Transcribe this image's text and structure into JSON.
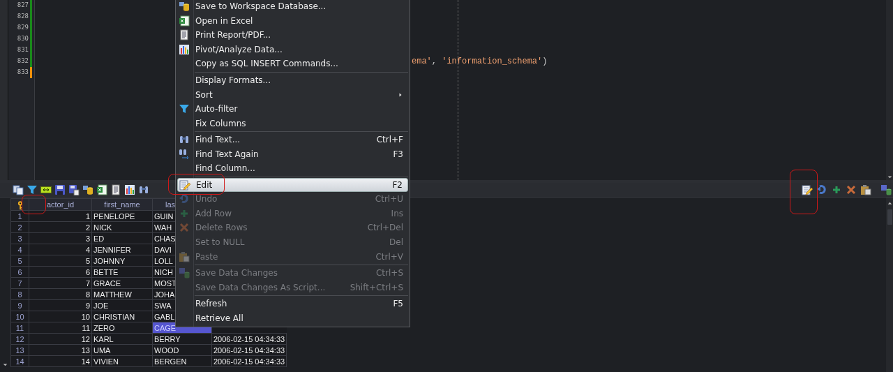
{
  "editor": {
    "lines": [
      {
        "number": "827",
        "color": "#1a8a1a"
      },
      {
        "number": "828",
        "color": "#1a8a1a"
      },
      {
        "number": "829",
        "color": "#1a8a1a"
      },
      {
        "number": "830",
        "color": "#1a8a1a"
      },
      {
        "number": "831",
        "color": "#1a8a1a"
      },
      {
        "number": "832",
        "color": "#1a8a1a",
        "code": [
          {
            "text": "ema'",
            "kind": "string"
          },
          {
            "text": ", ",
            "kind": "plain"
          },
          {
            "text": "'information_schema'",
            "kind": "string"
          },
          {
            "text": ")",
            "kind": "plain"
          }
        ]
      },
      {
        "number": "833",
        "color": "#f0900a"
      }
    ]
  },
  "table": {
    "columns": [
      {
        "key": true
      },
      {
        "label": "actor_id",
        "key": false
      },
      {
        "label": "first_name",
        "key": false
      },
      {
        "label": "las",
        "key": false
      }
    ],
    "rows": [
      {
        "cells": [
          "1",
          "1",
          "PENELOPE",
          "GUIN"
        ],
        "selected": false
      },
      {
        "cells": [
          "2",
          "2",
          "NICK",
          "WAH"
        ],
        "selected": false
      },
      {
        "cells": [
          "3",
          "3",
          "ED",
          "CHAS"
        ],
        "selected": false
      },
      {
        "cells": [
          "4",
          "4",
          "JENNIFER",
          "DAVI"
        ],
        "selected": false
      },
      {
        "cells": [
          "5",
          "5",
          "JOHNNY",
          "LOLL"
        ],
        "selected": false
      },
      {
        "cells": [
          "6",
          "6",
          "BETTE",
          "NICH"
        ],
        "selected": false
      },
      {
        "cells": [
          "7",
          "7",
          "GRACE",
          "MOST"
        ],
        "selected": false
      },
      {
        "cells": [
          "8",
          "8",
          "MATTHEW",
          "JOHA"
        ],
        "selected": false
      },
      {
        "cells": [
          "9",
          "9",
          "JOE",
          "SWA"
        ],
        "selected": false
      },
      {
        "cells": [
          "10",
          "10",
          "CHRISTIAN",
          "GABL"
        ],
        "selected": false
      },
      {
        "cells": [
          "11",
          "11",
          "ZERO",
          "CAGE"
        ],
        "selected": true
      },
      {
        "cells": [
          "12",
          "12",
          "KARL",
          "BERRY",
          "2006-02-15 04:34:33"
        ],
        "selected": false
      },
      {
        "cells": [
          "13",
          "13",
          "UMA",
          "WOOD",
          "2006-02-15 04:34:33"
        ],
        "selected": false
      },
      {
        "cells": [
          "14",
          "14",
          "VIVIEN",
          "BERGEN",
          "2006-02-15 04:34:33"
        ],
        "selected": false
      }
    ]
  },
  "context_menu": {
    "items": [
      {
        "kind": "item",
        "label": "Save to Workspace Database...",
        "disabled": false,
        "selected": false
      },
      {
        "kind": "item",
        "label": "Open in Excel",
        "disabled": false,
        "selected": false
      },
      {
        "kind": "item",
        "label": "Print Report/PDF...",
        "disabled": false,
        "selected": false
      },
      {
        "kind": "item",
        "label": "Pivot/Analyze Data...",
        "disabled": false,
        "selected": false
      },
      {
        "kind": "item",
        "label": "Copy as SQL INSERT Commands...",
        "disabled": false,
        "selected": false
      },
      {
        "kind": "separator"
      },
      {
        "kind": "item",
        "label": "Display Formats...",
        "disabled": false,
        "selected": false
      },
      {
        "kind": "submenu",
        "label": "Sort",
        "disabled": false,
        "selected": false
      },
      {
        "kind": "item",
        "label": "Auto-filter",
        "disabled": false,
        "selected": false
      },
      {
        "kind": "item",
        "label": "Fix Columns",
        "disabled": false,
        "selected": false
      },
      {
        "kind": "separator"
      },
      {
        "kind": "item",
        "label": "Find Text...",
        "shortcut": "Ctrl+F",
        "disabled": false,
        "selected": false
      },
      {
        "kind": "item",
        "label": "Find Text Again",
        "shortcut": "F3",
        "disabled": false,
        "selected": false
      },
      {
        "kind": "item",
        "label": "Find Column...",
        "disabled": false,
        "selected": false
      },
      {
        "kind": "separator"
      },
      {
        "kind": "item",
        "label": "Edit",
        "shortcut": "F2",
        "disabled": false,
        "selected": true
      },
      {
        "kind": "item",
        "label": "Undo",
        "shortcut": "Ctrl+U",
        "disabled": true,
        "selected": false
      },
      {
        "kind": "item",
        "label": "Add Row",
        "shortcut": "Ins",
        "disabled": true,
        "selected": false
      },
      {
        "kind": "item",
        "label": "Delete Rows",
        "shortcut": "Ctrl+Del",
        "disabled": true,
        "selected": false
      },
      {
        "kind": "item",
        "label": "Set to NULL",
        "shortcut": "Del",
        "disabled": true,
        "selected": false
      },
      {
        "kind": "item",
        "label": "Paste",
        "shortcut": "Ctrl+V",
        "disabled": true,
        "selected": false
      },
      {
        "kind": "separator"
      },
      {
        "kind": "item",
        "label": "Save Data Changes",
        "shortcut": "Ctrl+S",
        "disabled": true,
        "selected": false
      },
      {
        "kind": "item",
        "label": "Save Data Changes As Script...",
        "shortcut": "Shift+Ctrl+S",
        "disabled": true,
        "selected": false
      },
      {
        "kind": "separator"
      },
      {
        "kind": "item",
        "label": "Refresh",
        "shortcut": "F5",
        "disabled": false,
        "selected": false
      },
      {
        "kind": "item",
        "label": "Retrieve All",
        "disabled": false,
        "selected": false
      }
    ]
  }
}
